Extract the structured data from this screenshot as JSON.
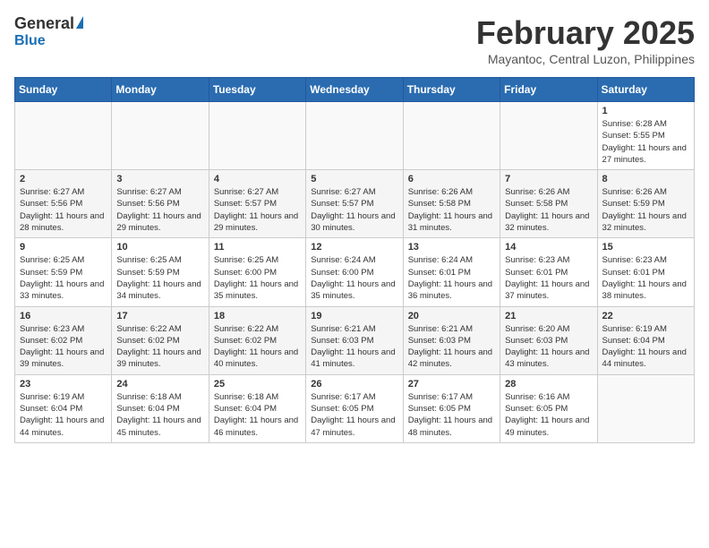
{
  "header": {
    "logo": {
      "general": "General",
      "blue": "Blue"
    },
    "title": "February 2025",
    "subtitle": "Mayantoc, Central Luzon, Philippines"
  },
  "weekdays": [
    "Sunday",
    "Monday",
    "Tuesday",
    "Wednesday",
    "Thursday",
    "Friday",
    "Saturday"
  ],
  "weeks": [
    [
      {
        "day": "",
        "info": ""
      },
      {
        "day": "",
        "info": ""
      },
      {
        "day": "",
        "info": ""
      },
      {
        "day": "",
        "info": ""
      },
      {
        "day": "",
        "info": ""
      },
      {
        "day": "",
        "info": ""
      },
      {
        "day": "1",
        "info": "Sunrise: 6:28 AM\nSunset: 5:55 PM\nDaylight: 11 hours and 27 minutes."
      }
    ],
    [
      {
        "day": "2",
        "info": "Sunrise: 6:27 AM\nSunset: 5:56 PM\nDaylight: 11 hours and 28 minutes."
      },
      {
        "day": "3",
        "info": "Sunrise: 6:27 AM\nSunset: 5:56 PM\nDaylight: 11 hours and 29 minutes."
      },
      {
        "day": "4",
        "info": "Sunrise: 6:27 AM\nSunset: 5:57 PM\nDaylight: 11 hours and 29 minutes."
      },
      {
        "day": "5",
        "info": "Sunrise: 6:27 AM\nSunset: 5:57 PM\nDaylight: 11 hours and 30 minutes."
      },
      {
        "day": "6",
        "info": "Sunrise: 6:26 AM\nSunset: 5:58 PM\nDaylight: 11 hours and 31 minutes."
      },
      {
        "day": "7",
        "info": "Sunrise: 6:26 AM\nSunset: 5:58 PM\nDaylight: 11 hours and 32 minutes."
      },
      {
        "day": "8",
        "info": "Sunrise: 6:26 AM\nSunset: 5:59 PM\nDaylight: 11 hours and 32 minutes."
      }
    ],
    [
      {
        "day": "9",
        "info": "Sunrise: 6:25 AM\nSunset: 5:59 PM\nDaylight: 11 hours and 33 minutes."
      },
      {
        "day": "10",
        "info": "Sunrise: 6:25 AM\nSunset: 5:59 PM\nDaylight: 11 hours and 34 minutes."
      },
      {
        "day": "11",
        "info": "Sunrise: 6:25 AM\nSunset: 6:00 PM\nDaylight: 11 hours and 35 minutes."
      },
      {
        "day": "12",
        "info": "Sunrise: 6:24 AM\nSunset: 6:00 PM\nDaylight: 11 hours and 35 minutes."
      },
      {
        "day": "13",
        "info": "Sunrise: 6:24 AM\nSunset: 6:01 PM\nDaylight: 11 hours and 36 minutes."
      },
      {
        "day": "14",
        "info": "Sunrise: 6:23 AM\nSunset: 6:01 PM\nDaylight: 11 hours and 37 minutes."
      },
      {
        "day": "15",
        "info": "Sunrise: 6:23 AM\nSunset: 6:01 PM\nDaylight: 11 hours and 38 minutes."
      }
    ],
    [
      {
        "day": "16",
        "info": "Sunrise: 6:23 AM\nSunset: 6:02 PM\nDaylight: 11 hours and 39 minutes."
      },
      {
        "day": "17",
        "info": "Sunrise: 6:22 AM\nSunset: 6:02 PM\nDaylight: 11 hours and 39 minutes."
      },
      {
        "day": "18",
        "info": "Sunrise: 6:22 AM\nSunset: 6:02 PM\nDaylight: 11 hours and 40 minutes."
      },
      {
        "day": "19",
        "info": "Sunrise: 6:21 AM\nSunset: 6:03 PM\nDaylight: 11 hours and 41 minutes."
      },
      {
        "day": "20",
        "info": "Sunrise: 6:21 AM\nSunset: 6:03 PM\nDaylight: 11 hours and 42 minutes."
      },
      {
        "day": "21",
        "info": "Sunrise: 6:20 AM\nSunset: 6:03 PM\nDaylight: 11 hours and 43 minutes."
      },
      {
        "day": "22",
        "info": "Sunrise: 6:19 AM\nSunset: 6:04 PM\nDaylight: 11 hours and 44 minutes."
      }
    ],
    [
      {
        "day": "23",
        "info": "Sunrise: 6:19 AM\nSunset: 6:04 PM\nDaylight: 11 hours and 44 minutes."
      },
      {
        "day": "24",
        "info": "Sunrise: 6:18 AM\nSunset: 6:04 PM\nDaylight: 11 hours and 45 minutes."
      },
      {
        "day": "25",
        "info": "Sunrise: 6:18 AM\nSunset: 6:04 PM\nDaylight: 11 hours and 46 minutes."
      },
      {
        "day": "26",
        "info": "Sunrise: 6:17 AM\nSunset: 6:05 PM\nDaylight: 11 hours and 47 minutes."
      },
      {
        "day": "27",
        "info": "Sunrise: 6:17 AM\nSunset: 6:05 PM\nDaylight: 11 hours and 48 minutes."
      },
      {
        "day": "28",
        "info": "Sunrise: 6:16 AM\nSunset: 6:05 PM\nDaylight: 11 hours and 49 minutes."
      },
      {
        "day": "",
        "info": ""
      }
    ]
  ]
}
